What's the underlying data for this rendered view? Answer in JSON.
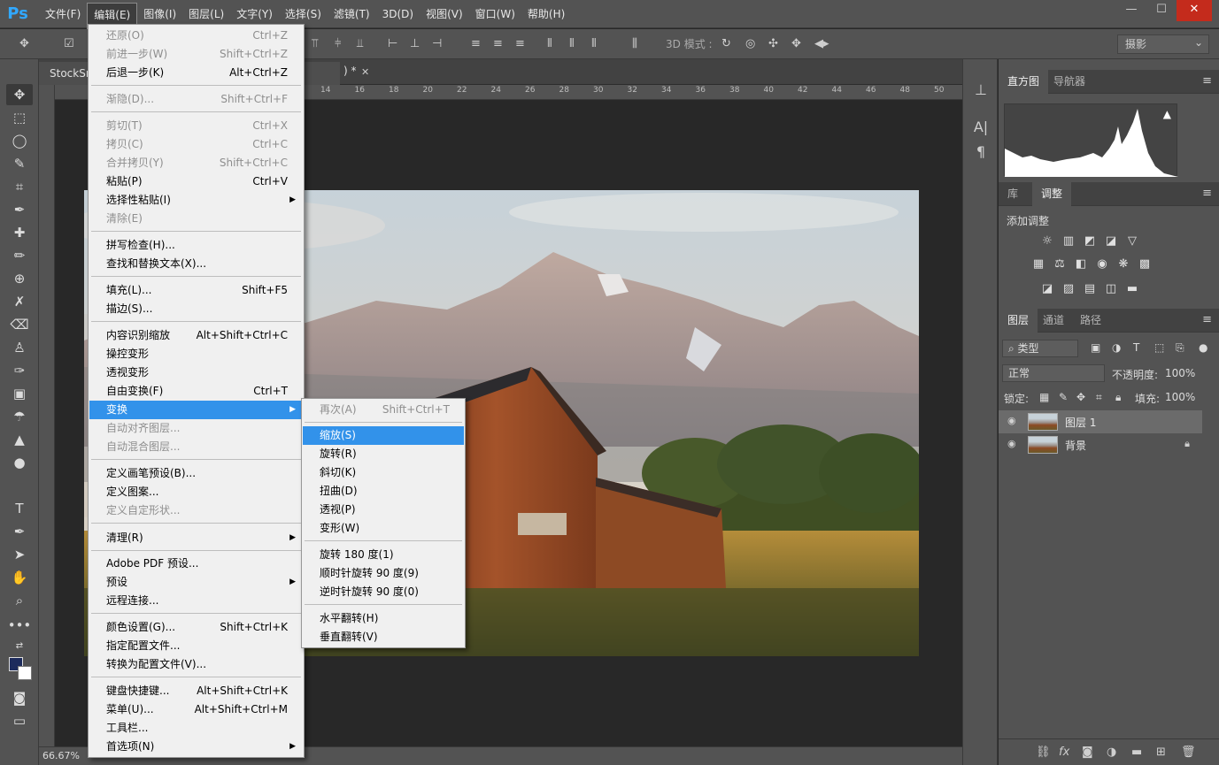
{
  "app": {
    "logo": "Ps"
  },
  "menubar": {
    "items": [
      "文件(F)",
      "编辑(E)",
      "图像(I)",
      "图层(L)",
      "文字(Y)",
      "选择(S)",
      "滤镜(T)",
      "3D(D)",
      "视图(V)",
      "窗口(W)",
      "帮助(H)"
    ],
    "active": "编辑(E)"
  },
  "window_controls": {
    "minimize": "—",
    "maximize": "☐",
    "close": "✕"
  },
  "options_bar": {
    "threed_mode": "3D 模式 :",
    "workspace": "摄影"
  },
  "document": {
    "tab_title": "StockSnap",
    "tab_suffix": ") *",
    "close": "✕",
    "zoom": "66.67%",
    "ruler_ticks": [
      "14",
      "16",
      "18",
      "20",
      "22",
      "24",
      "26",
      "28",
      "30",
      "32",
      "34",
      "36",
      "38",
      "40",
      "42",
      "44",
      "46",
      "48",
      "50"
    ]
  },
  "edit_menu": {
    "items": [
      {
        "label": "还原(O)",
        "shortcut": "Ctrl+Z",
        "disabled": true
      },
      {
        "label": "前进一步(W)",
        "shortcut": "Shift+Ctrl+Z",
        "disabled": true
      },
      {
        "label": "后退一步(K)",
        "shortcut": "Alt+Ctrl+Z",
        "disabled": false
      },
      {
        "label": "渐隐(D)...",
        "shortcut": "Shift+Ctrl+F",
        "disabled": true
      },
      {
        "label": "剪切(T)",
        "shortcut": "Ctrl+X",
        "disabled": true
      },
      {
        "label": "拷贝(C)",
        "shortcut": "Ctrl+C",
        "disabled": true
      },
      {
        "label": "合并拷贝(Y)",
        "shortcut": "Shift+Ctrl+C",
        "disabled": true
      },
      {
        "label": "粘贴(P)",
        "shortcut": "Ctrl+V",
        "disabled": false
      },
      {
        "label": "选择性粘贴(I)",
        "shortcut": "",
        "disabled": false
      },
      {
        "label": "清除(E)",
        "shortcut": "",
        "disabled": true
      },
      {
        "label": "拼写检查(H)...",
        "shortcut": "",
        "disabled": false
      },
      {
        "label": "查找和替换文本(X)...",
        "shortcut": "",
        "disabled": false
      },
      {
        "label": "填充(L)...",
        "shortcut": "Shift+F5",
        "disabled": false
      },
      {
        "label": "描边(S)...",
        "shortcut": "",
        "disabled": false
      },
      {
        "label": "内容识别缩放",
        "shortcut": "Alt+Shift+Ctrl+C",
        "disabled": false
      },
      {
        "label": "操控变形",
        "shortcut": "",
        "disabled": false
      },
      {
        "label": "透视变形",
        "shortcut": "",
        "disabled": false
      },
      {
        "label": "自由变换(F)",
        "shortcut": "Ctrl+T",
        "disabled": false
      },
      {
        "label": "变换",
        "shortcut": "",
        "disabled": false
      },
      {
        "label": "自动对齐图层...",
        "shortcut": "",
        "disabled": true
      },
      {
        "label": "自动混合图层...",
        "shortcut": "",
        "disabled": true
      },
      {
        "label": "定义画笔预设(B)...",
        "shortcut": "",
        "disabled": false
      },
      {
        "label": "定义图案...",
        "shortcut": "",
        "disabled": false
      },
      {
        "label": "定义自定形状...",
        "shortcut": "",
        "disabled": true
      },
      {
        "label": "清理(R)",
        "shortcut": "",
        "disabled": false
      },
      {
        "label": "Adobe PDF 预设...",
        "shortcut": "",
        "disabled": false
      },
      {
        "label": "预设",
        "shortcut": "",
        "disabled": false
      },
      {
        "label": "远程连接...",
        "shortcut": "",
        "disabled": false
      },
      {
        "label": "颜色设置(G)...",
        "shortcut": "Shift+Ctrl+K",
        "disabled": false
      },
      {
        "label": "指定配置文件...",
        "shortcut": "",
        "disabled": false
      },
      {
        "label": "转换为配置文件(V)...",
        "shortcut": "",
        "disabled": false
      },
      {
        "label": "键盘快捷键...",
        "shortcut": "Alt+Shift+Ctrl+K",
        "disabled": false
      },
      {
        "label": "菜单(U)...",
        "shortcut": "Alt+Shift+Ctrl+M",
        "disabled": false
      },
      {
        "label": "工具栏...",
        "shortcut": "",
        "disabled": false
      },
      {
        "label": "首选项(N)",
        "shortcut": "",
        "disabled": false
      }
    ],
    "submenu_arrow": "▶"
  },
  "transform_submenu": {
    "items": [
      {
        "label": "再次(A)",
        "shortcut": "Shift+Ctrl+T",
        "disabled": true
      },
      {
        "label": "缩放(S)",
        "shortcut": "",
        "disabled": false
      },
      {
        "label": "旋转(R)",
        "shortcut": "",
        "disabled": false
      },
      {
        "label": "斜切(K)",
        "shortcut": "",
        "disabled": false
      },
      {
        "label": "扭曲(D)",
        "shortcut": "",
        "disabled": false
      },
      {
        "label": "透视(P)",
        "shortcut": "",
        "disabled": false
      },
      {
        "label": "变形(W)",
        "shortcut": "",
        "disabled": false
      },
      {
        "label": "旋转 180 度(1)",
        "shortcut": "",
        "disabled": false
      },
      {
        "label": "顺时针旋转 90 度(9)",
        "shortcut": "",
        "disabled": false
      },
      {
        "label": "逆时针旋转 90 度(0)",
        "shortcut": "",
        "disabled": false
      },
      {
        "label": "水平翻转(H)",
        "shortcut": "",
        "disabled": false
      },
      {
        "label": "垂直翻转(V)",
        "shortcut": "",
        "disabled": false
      }
    ]
  },
  "panels": {
    "histogram_tabs": [
      "直方图",
      "导航器"
    ],
    "adjust_tabs": [
      "库",
      "调整"
    ],
    "add_adjustment": "添加调整",
    "layers_tabs": [
      "图层",
      "通道",
      "路径"
    ],
    "filter_kind": "类型",
    "blend_mode": "正常",
    "opacity_label": "不透明度:",
    "opacity_value": "100%",
    "lock_label": "锁定:",
    "fill_label": "填充:",
    "fill_value": "100%",
    "layers": [
      {
        "name": "图层 1",
        "selected": true,
        "locked": false
      },
      {
        "name": "背景",
        "selected": false,
        "locked": true
      }
    ],
    "footer_fx": "fx"
  },
  "colors": {
    "foreground": "#1d2b5c",
    "background": "#ffffff",
    "highlight": "#3292ea"
  }
}
